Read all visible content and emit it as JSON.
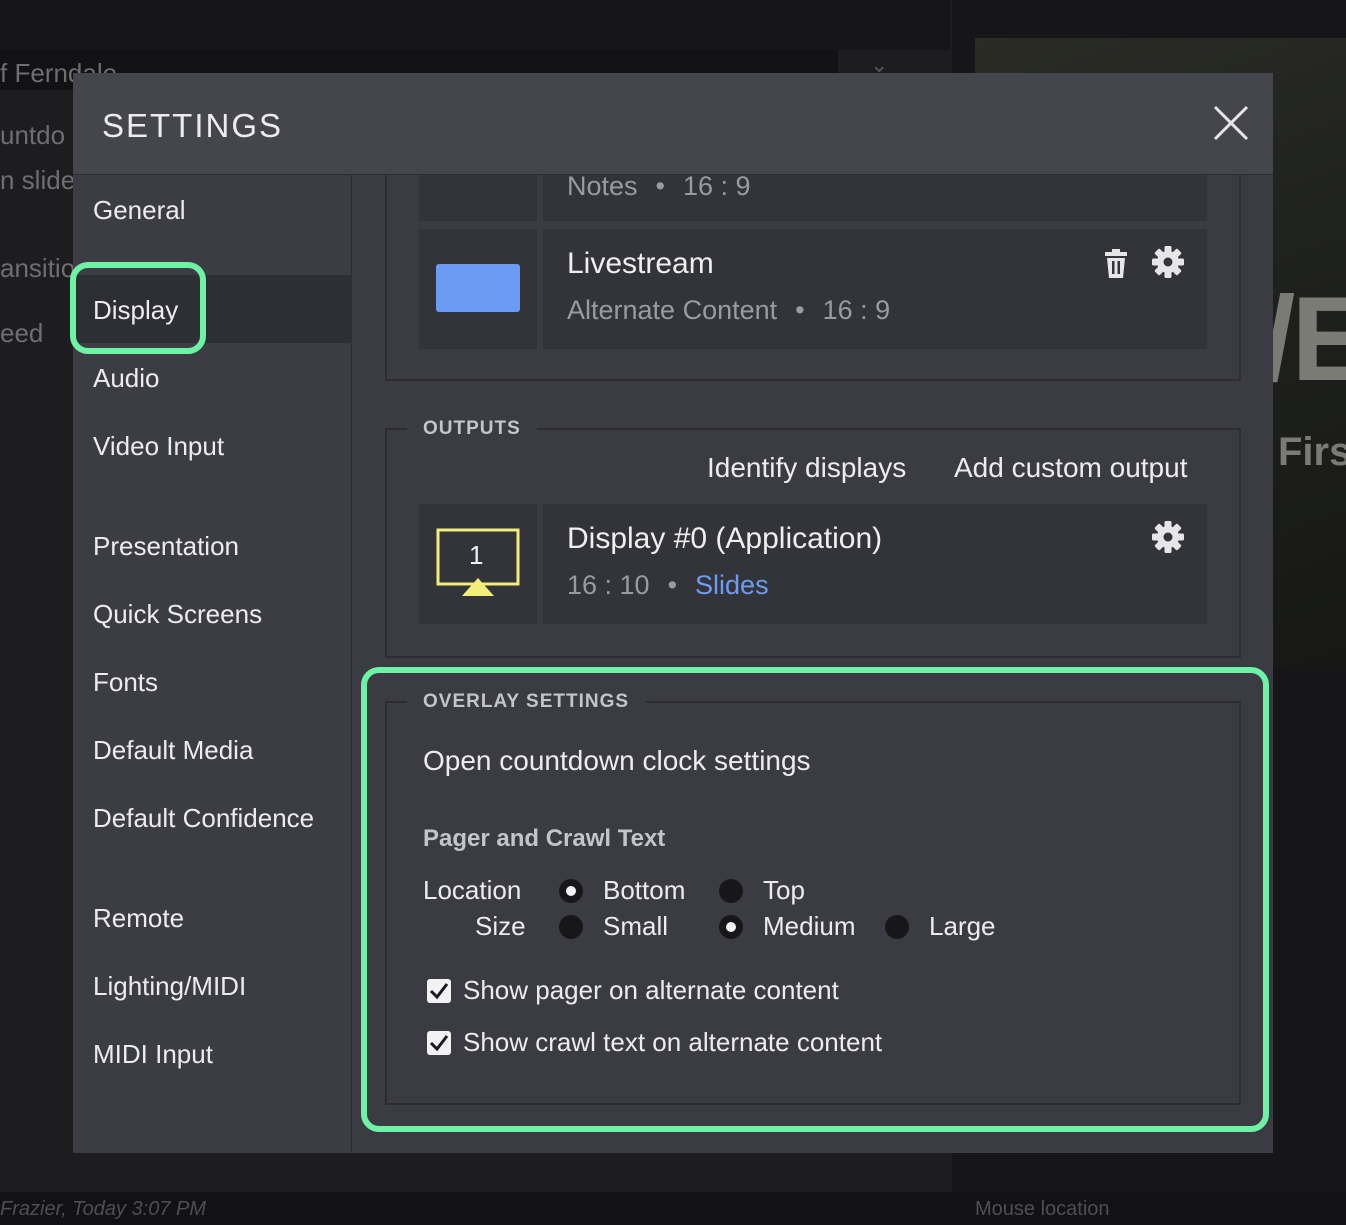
{
  "background": {
    "left_fragments": [
      "f Ferndale",
      "untdo",
      "n slide",
      "ansition",
      "eed"
    ],
    "right_big_text": "/E",
    "right_sub_text": "Firs",
    "footer_left": "Frazier, Today 3:07 PM",
    "footer_right": "Mouse location"
  },
  "modal": {
    "title": "SETTINGS",
    "close_icon": "close-icon"
  },
  "sidebar": {
    "active": "Display",
    "items": [
      {
        "label": "General"
      },
      {
        "label": "Display"
      },
      {
        "label": "Audio"
      },
      {
        "label": "Video Input"
      },
      {
        "label": "Presentation"
      },
      {
        "label": "Quick Screens"
      },
      {
        "label": "Fonts"
      },
      {
        "label": "Default Media"
      },
      {
        "label": "Default Confidence"
      },
      {
        "label": "Remote"
      },
      {
        "label": "Lighting/MIDI"
      },
      {
        "label": "MIDI Input"
      }
    ]
  },
  "screens": {
    "partial_card": {
      "type": "Notes",
      "ratio": "16 : 9"
    },
    "livestream_card": {
      "title": "Livestream",
      "type": "Alternate Content",
      "ratio": "16 : 9",
      "swatch_color": "#6c9bf3"
    }
  },
  "outputs": {
    "legend": "OUTPUTS",
    "identify_link": "Identify displays",
    "add_link": "Add custom output",
    "display_card": {
      "title": "Display #0 (Application)",
      "ratio": "16 : 10",
      "content": "Slides",
      "monitor_number": "1",
      "monitor_color": "#f2ee7a"
    }
  },
  "overlay": {
    "legend": "OVERLAY SETTINGS",
    "countdown_link": "Open countdown clock settings",
    "pager_heading": "Pager and Crawl Text",
    "location": {
      "label": "Location",
      "options": [
        "Bottom",
        "Top"
      ],
      "selected": "Bottom"
    },
    "size": {
      "label": "Size",
      "options": [
        "Small",
        "Medium",
        "Large"
      ],
      "selected": "Medium"
    },
    "checkboxes": [
      {
        "label": "Show pager on alternate content",
        "checked": true
      },
      {
        "label": "Show crawl text on alternate content",
        "checked": true
      }
    ]
  },
  "colors": {
    "accent_link": "#6d9cf6",
    "highlight": "#6ef3a6"
  }
}
